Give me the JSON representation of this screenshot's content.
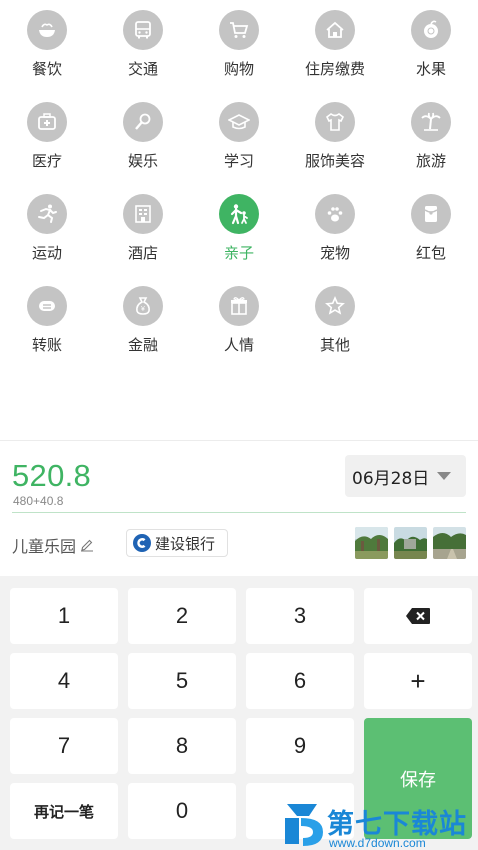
{
  "categories": [
    {
      "label": "餐饮",
      "icon": "bowl-icon"
    },
    {
      "label": "交通",
      "icon": "bus-icon"
    },
    {
      "label": "购物",
      "icon": "cart-icon"
    },
    {
      "label": "住房缴费",
      "icon": "house-icon"
    },
    {
      "label": "水果",
      "icon": "fruit-icon"
    },
    {
      "label": "医疗",
      "icon": "medkit-icon"
    },
    {
      "label": "娱乐",
      "icon": "microphone-icon"
    },
    {
      "label": "学习",
      "icon": "graduation-cap-icon"
    },
    {
      "label": "服饰美容",
      "icon": "shirt-icon"
    },
    {
      "label": "旅游",
      "icon": "palm-tree-icon"
    },
    {
      "label": "运动",
      "icon": "running-icon"
    },
    {
      "label": "酒店",
      "icon": "hotel-icon"
    },
    {
      "label": "亲子",
      "icon": "parent-child-icon",
      "active": true
    },
    {
      "label": "宠物",
      "icon": "paw-icon"
    },
    {
      "label": "红包",
      "icon": "red-envelope-icon"
    },
    {
      "label": "转账",
      "icon": "transfer-icon"
    },
    {
      "label": "金融",
      "icon": "money-bag-icon"
    },
    {
      "label": "人情",
      "icon": "gift-icon"
    },
    {
      "label": "其他",
      "icon": "star-icon"
    }
  ],
  "entry": {
    "amount": "520.8",
    "formula": "480+40.8",
    "date": "06月28日",
    "note": "儿童乐园",
    "account": "建设银行"
  },
  "keypad": {
    "k1": "1",
    "k2": "2",
    "k3": "3",
    "k4": "4",
    "k5": "5",
    "k6": "6",
    "k7": "7",
    "k8": "8",
    "k9": "9",
    "k0": "0",
    "plus": "+",
    "again": "再记一笔",
    "save": "保存"
  },
  "watermark": {
    "title": "第七下载站",
    "url": "www.d7down.com"
  },
  "colors": {
    "accent": "#3fb463",
    "icon_gray": "#c4c4c4",
    "save_button": "#5cbf73",
    "watermark": "#1a87d6"
  }
}
